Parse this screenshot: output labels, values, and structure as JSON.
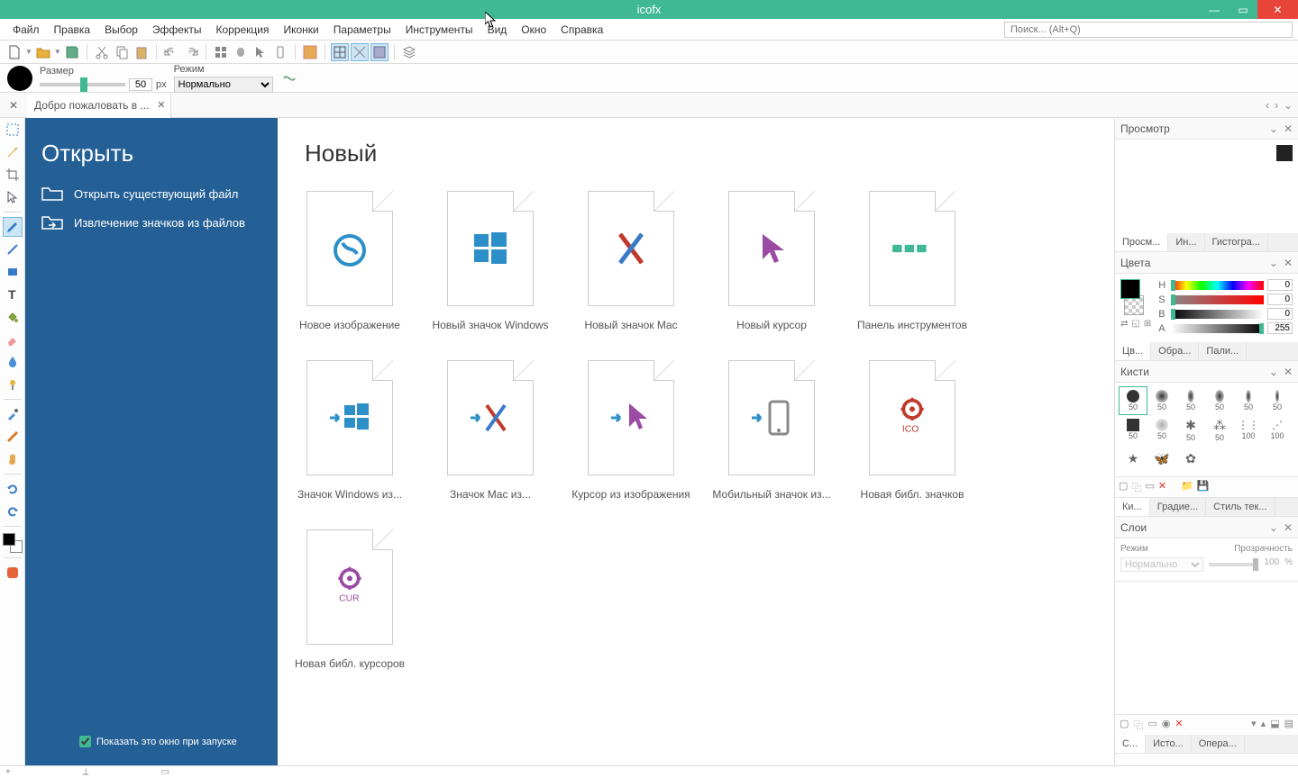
{
  "title": "icofx",
  "menu": [
    "Файл",
    "Правка",
    "Выбор",
    "Эффекты",
    "Коррекция",
    "Иконки",
    "Параметры",
    "Инструменты",
    "Вид",
    "Окно",
    "Справка"
  ],
  "search_placeholder": "Поиск... (Alt+Q)",
  "sizebar": {
    "size_label": "Размер",
    "size_value": "50",
    "px": "px",
    "mode_label": "Режим",
    "mode_value": "Нормально"
  },
  "tab": {
    "title": "Добро пожаловать в ..."
  },
  "welcome": {
    "open_title": "Открыть",
    "open_actions": [
      "Открыть существующий файл",
      "Извлечение значков из файлов"
    ],
    "new_title": "Новый",
    "startup_label": "Показать это окно при запуске",
    "items": [
      "Новое изображение",
      "Новый значок Windows",
      "Новый значок Mac",
      "Новый курсор",
      "Панель инструментов",
      "Значок Windows из...",
      "Значок Mac из...",
      "Курсор из изображения",
      "Мобильный значок из...",
      "Новая библ. значков",
      "Новая библ. курсоров"
    ]
  },
  "panels": {
    "preview": "Просмотр",
    "preview_tabs": [
      "Просм...",
      "Ин...",
      "Гистогра..."
    ],
    "colors": "Цвета",
    "color_labels": [
      "H",
      "S",
      "B",
      "A"
    ],
    "color_values": [
      "0",
      "0",
      "0",
      "255"
    ],
    "color_tabs": [
      "Цв...",
      "Обра...",
      "Пали..."
    ],
    "brushes": "Кисти",
    "brush_sizes": [
      "50",
      "50",
      "50",
      "50",
      "50",
      "50",
      "50",
      "50",
      "50",
      "50",
      "100",
      "100"
    ],
    "brush_tabs": [
      "Ки...",
      "Градие...",
      "Стиль тек..."
    ],
    "layers": "Слои",
    "layer_mode_label": "Режим",
    "layer_opacity_label": "Прозрачность",
    "layer_mode_value": "Нормально",
    "layer_opacity_value": "100",
    "layer_opacity_pct": "%",
    "layer_tabs": [
      "С...",
      "Исто...",
      "Опера..."
    ]
  }
}
